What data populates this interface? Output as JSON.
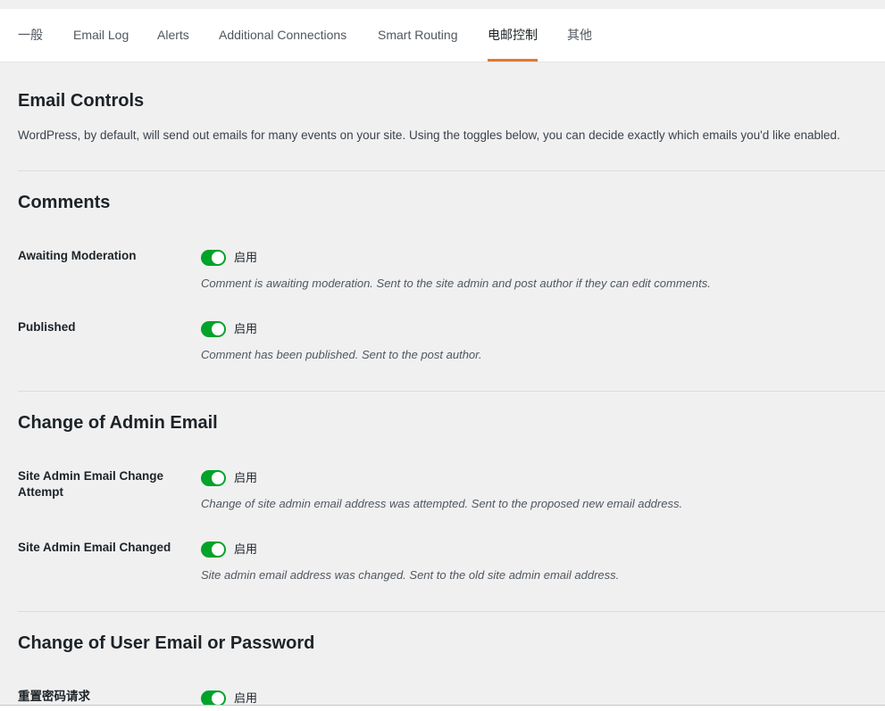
{
  "tabs": [
    {
      "label": "一般"
    },
    {
      "label": "Email Log"
    },
    {
      "label": "Alerts"
    },
    {
      "label": "Additional Connections"
    },
    {
      "label": "Smart Routing"
    },
    {
      "label": "电邮控制",
      "active": true
    },
    {
      "label": "其他"
    }
  ],
  "page": {
    "title": "Email Controls",
    "description": "WordPress, by default, will send out emails for many events on your site. Using the toggles below, you can decide exactly which emails you'd like enabled."
  },
  "colors": {
    "accent": "#e27730",
    "toggle_on": "#00a32a"
  },
  "sections": [
    {
      "title": "Comments",
      "rows": [
        {
          "label": "Awaiting Moderation",
          "toggle_text": "启用",
          "enabled": true,
          "description": "Comment is awaiting moderation. Sent to the site admin and post author if they can edit comments."
        },
        {
          "label": "Published",
          "toggle_text": "启用",
          "enabled": true,
          "description": "Comment has been published. Sent to the post author."
        }
      ]
    },
    {
      "title": "Change of Admin Email",
      "rows": [
        {
          "label": "Site Admin Email Change Attempt",
          "toggle_text": "启用",
          "enabled": true,
          "description": "Change of site admin email address was attempted. Sent to the proposed new email address."
        },
        {
          "label": "Site Admin Email Changed",
          "toggle_text": "启用",
          "enabled": true,
          "description": "Site admin email address was changed. Sent to the old site admin email address."
        }
      ]
    },
    {
      "title": "Change of User Email or Password",
      "rows": [
        {
          "label": "重置密码请求",
          "toggle_text": "启用",
          "enabled": true
        }
      ]
    }
  ]
}
